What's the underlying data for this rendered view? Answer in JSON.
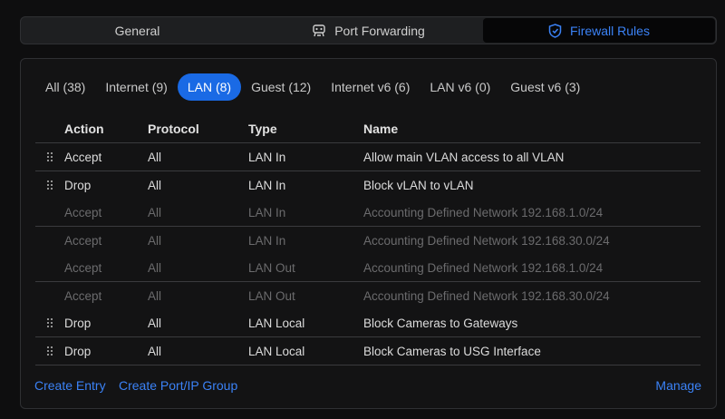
{
  "tabs": {
    "general": "General",
    "port_forwarding": "Port Forwarding",
    "firewall_rules": "Firewall Rules",
    "active": "firewall_rules"
  },
  "filters": [
    {
      "label": "All (38)",
      "active": false
    },
    {
      "label": "Internet (9)",
      "active": false
    },
    {
      "label": "LAN (8)",
      "active": true
    },
    {
      "label": "Guest (12)",
      "active": false
    },
    {
      "label": "Internet v6 (6)",
      "active": false
    },
    {
      "label": "LAN v6 (0)",
      "active": false
    },
    {
      "label": "Guest v6 (3)",
      "active": false
    }
  ],
  "table": {
    "headers": {
      "action": "Action",
      "protocol": "Protocol",
      "type": "Type",
      "name": "Name"
    },
    "rows": [
      {
        "action": "Accept",
        "protocol": "All",
        "type": "LAN In",
        "name": "Allow main VLAN access to all VLAN",
        "enabled": true
      },
      {
        "action": "Drop",
        "protocol": "All",
        "type": "LAN In",
        "name": "Block vLAN to vLAN",
        "enabled": true
      },
      {
        "action": "Accept",
        "protocol": "All",
        "type": "LAN In",
        "name": "Accounting Defined Network 192.168.1.0/24",
        "enabled": false
      },
      {
        "action": "Accept",
        "protocol": "All",
        "type": "LAN In",
        "name": "Accounting Defined Network 192.168.30.0/24",
        "enabled": false
      },
      {
        "action": "Accept",
        "protocol": "All",
        "type": "LAN Out",
        "name": "Accounting Defined Network 192.168.1.0/24",
        "enabled": false
      },
      {
        "action": "Accept",
        "protocol": "All",
        "type": "LAN Out",
        "name": "Accounting Defined Network 192.168.30.0/24",
        "enabled": false
      },
      {
        "action": "Drop",
        "protocol": "All",
        "type": "LAN Local",
        "name": "Block Cameras to Gateways",
        "enabled": true
      },
      {
        "action": "Drop",
        "protocol": "All",
        "type": "LAN Local",
        "name": "Block Cameras to USG Interface",
        "enabled": true
      }
    ]
  },
  "footer": {
    "create_entry": "Create Entry",
    "create_group": "Create Port/IP Group",
    "manage": "Manage"
  },
  "colors": {
    "accent": "#3b82f6",
    "active_chip": "#1a6ae5"
  },
  "icons": {
    "port_forwarding": "port-forward-icon",
    "firewall": "shield-icon",
    "drag": "drag-handle-icon"
  }
}
